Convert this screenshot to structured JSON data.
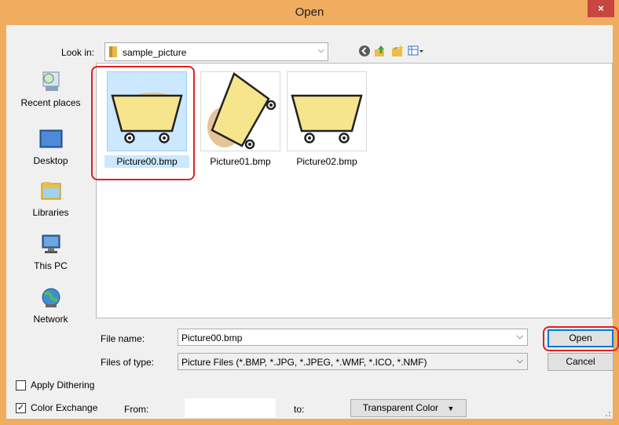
{
  "window": {
    "title": "Open",
    "close_glyph": "×"
  },
  "lookin": {
    "label": "Look in:",
    "value": "sample_picture"
  },
  "toolbar": {
    "icons": [
      "back-icon",
      "up-folder-icon",
      "new-folder-icon",
      "view-menu-icon"
    ]
  },
  "places": [
    {
      "label": "Recent places",
      "icon": "recent-places-icon"
    },
    {
      "label": "Desktop",
      "icon": "desktop-icon"
    },
    {
      "label": "Libraries",
      "icon": "libraries-icon"
    },
    {
      "label": "This PC",
      "icon": "this-pc-icon"
    },
    {
      "label": "Network",
      "icon": "network-icon"
    }
  ],
  "files": [
    {
      "name": "Picture00.bmp",
      "selected": true
    },
    {
      "name": "Picture01.bmp",
      "selected": false
    },
    {
      "name": "Picture02.bmp",
      "selected": false
    }
  ],
  "filename": {
    "label": "File name:",
    "value": "Picture00.bmp"
  },
  "filetype": {
    "label": "Files of type:",
    "value": "Picture Files (*.BMP, *.JPG, *.JPEG, *.WMF, *.ICO, *.NMF)"
  },
  "buttons": {
    "open": "Open",
    "cancel": "Cancel"
  },
  "options": {
    "dithering": {
      "label": "Apply Dithering",
      "checked": false
    },
    "color_exchange": {
      "label": "Color Exchange",
      "checked": true,
      "check_glyph": "✓"
    },
    "from_label": "From:",
    "to_label": "to:",
    "transparent_button": "Transparent Color"
  },
  "colors": {
    "titlebar": "#f0ac5f",
    "close": "#c7463f",
    "highlight": "#e02121",
    "selection": "#cce8ff",
    "cart_fill": "#f6e58d",
    "sand": "#e6c49a"
  }
}
